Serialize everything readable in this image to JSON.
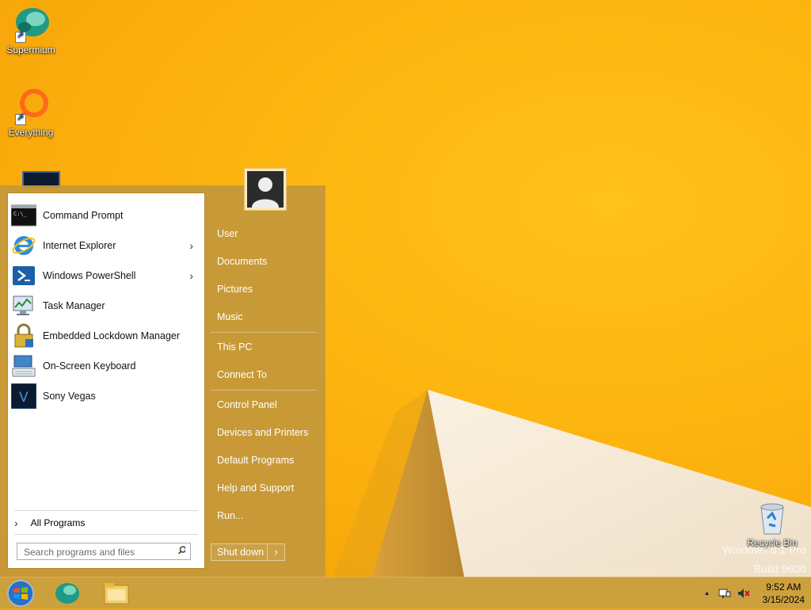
{
  "desktop": {
    "icons": [
      {
        "label": "Supermium"
      },
      {
        "label": "Everything"
      },
      {
        "label": "Recycle Bin"
      }
    ],
    "watermark": {
      "line1": "Windows 8.1 Pro",
      "line2": "Build 9600"
    }
  },
  "start_menu": {
    "programs": [
      {
        "label": "Command Prompt",
        "icon": "command-prompt-icon",
        "has_submenu": false
      },
      {
        "label": "Internet Explorer",
        "icon": "internet-explorer-icon",
        "has_submenu": true
      },
      {
        "label": "Windows PowerShell",
        "icon": "powershell-icon",
        "has_submenu": true
      },
      {
        "label": "Task Manager",
        "icon": "task-manager-icon",
        "has_submenu": false
      },
      {
        "label": "Embedded Lockdown Manager",
        "icon": "lockdown-manager-icon",
        "has_submenu": false
      },
      {
        "label": "On-Screen Keyboard",
        "icon": "keyboard-icon",
        "has_submenu": false
      },
      {
        "label": "Sony Vegas",
        "icon": "sony-vegas-icon",
        "has_submenu": false
      }
    ],
    "all_programs": "All Programs",
    "search_placeholder": "Search programs and files",
    "right": {
      "user": "User",
      "documents": "Documents",
      "pictures": "Pictures",
      "music": "Music",
      "this_pc": "This PC",
      "connect_to": "Connect To",
      "control_panel": "Control Panel",
      "devices_printers": "Devices and Printers",
      "default_programs": "Default Programs",
      "help_support": "Help and Support",
      "run": "Run..."
    },
    "shutdown": {
      "label": "Shut down",
      "more": "›"
    }
  },
  "taskbar": {
    "clock": {
      "time": "9:52 AM",
      "date": "3/15/2024"
    },
    "tray_expand": "▲"
  },
  "colors": {
    "accent": "#c4983a",
    "wallpaper": "#fdb40f"
  }
}
